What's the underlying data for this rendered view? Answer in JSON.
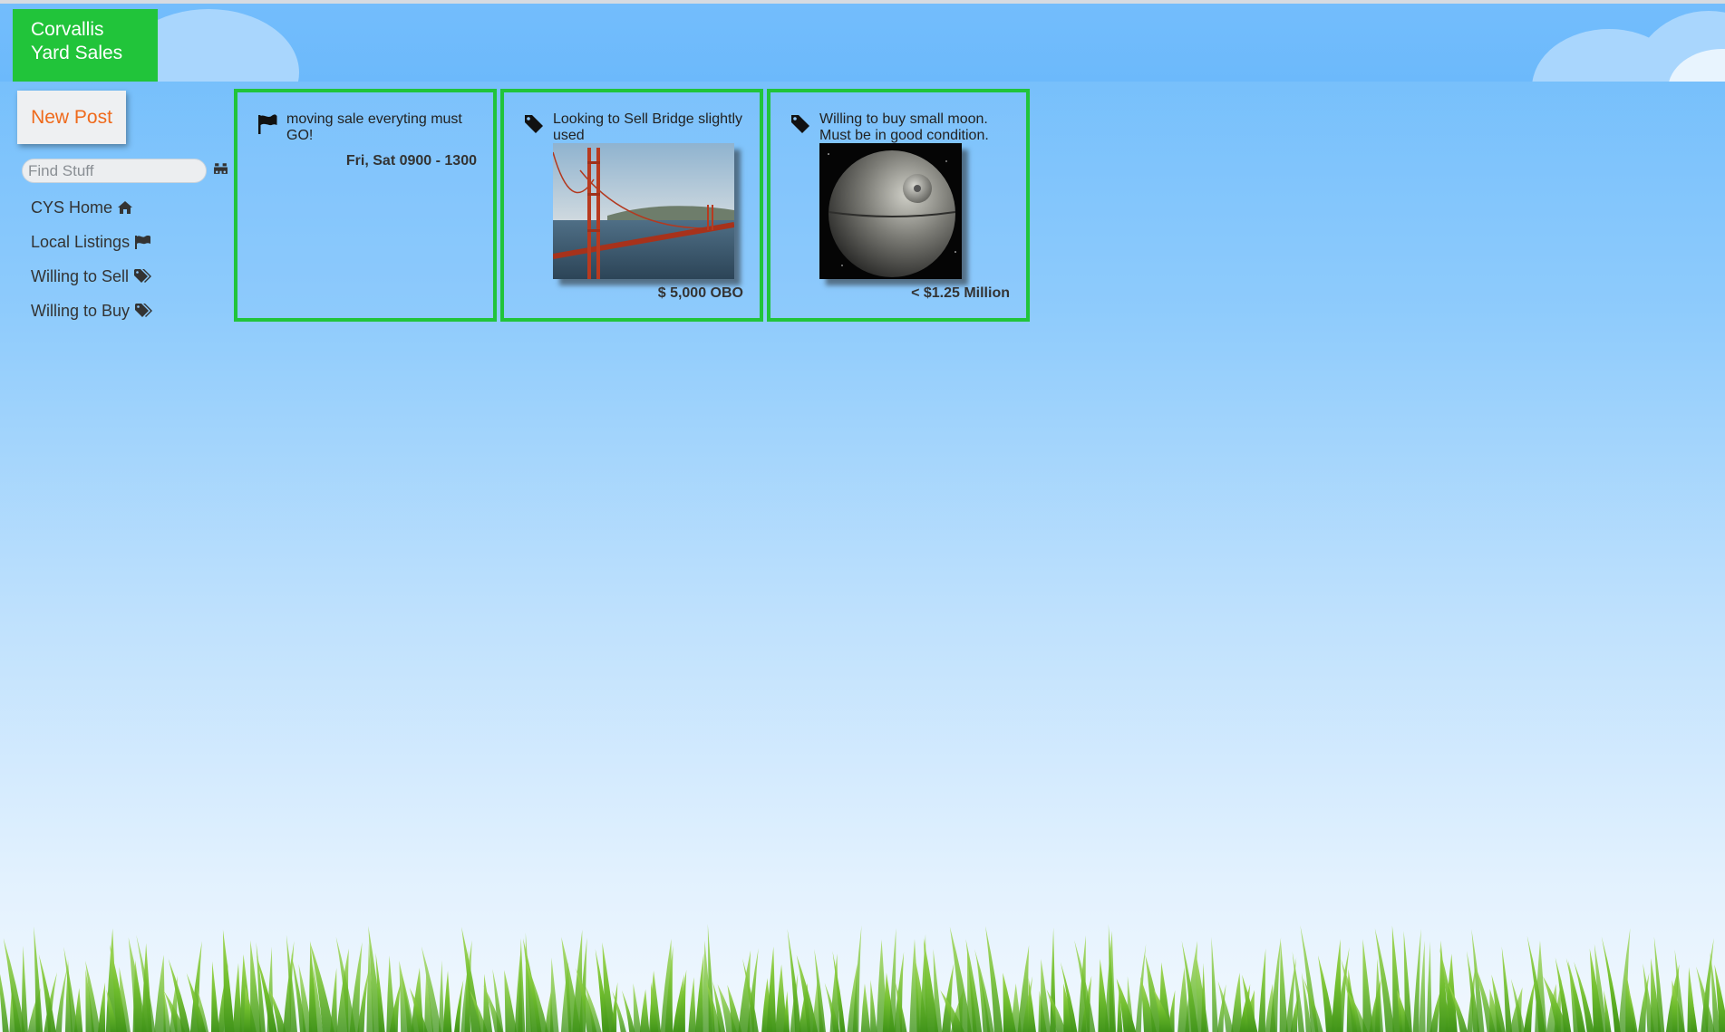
{
  "app": {
    "logo_line1": "Corvallis",
    "logo_line2": "Yard Sales"
  },
  "sidebar": {
    "new_post_label": "New Post",
    "search_placeholder": "Find Stuff",
    "search_icon": "binoculars-icon",
    "nav_items": [
      {
        "label": "CYS Home",
        "icon": "home-icon"
      },
      {
        "label": "Local Listings",
        "icon": "flag-icon"
      },
      {
        "label": "Willing to Sell",
        "icon": "tags-icon"
      },
      {
        "label": "Willing to Buy",
        "icon": "tags-icon"
      }
    ]
  },
  "posts": [
    {
      "icon": "flag-icon",
      "title": "moving sale everyting must GO!",
      "footer": "Fri, Sat 0900 - 1300"
    },
    {
      "icon": "tag-icon",
      "title": "Looking to Sell Bridge slightly used",
      "image": "golden-gate-bridge-photo",
      "footer": "$ 5,000 OBO"
    },
    {
      "icon": "tag-icon",
      "title": "Willing to buy small moon. Must be in good condition.",
      "image": "death-star-photo",
      "footer": "< $1.25 Million"
    }
  ],
  "colors": {
    "accent_green": "#21c43a",
    "new_post_text": "#ef6a1c",
    "sky_top": "#6fbcfb",
    "sky_bottom": "#f1f8fe"
  }
}
